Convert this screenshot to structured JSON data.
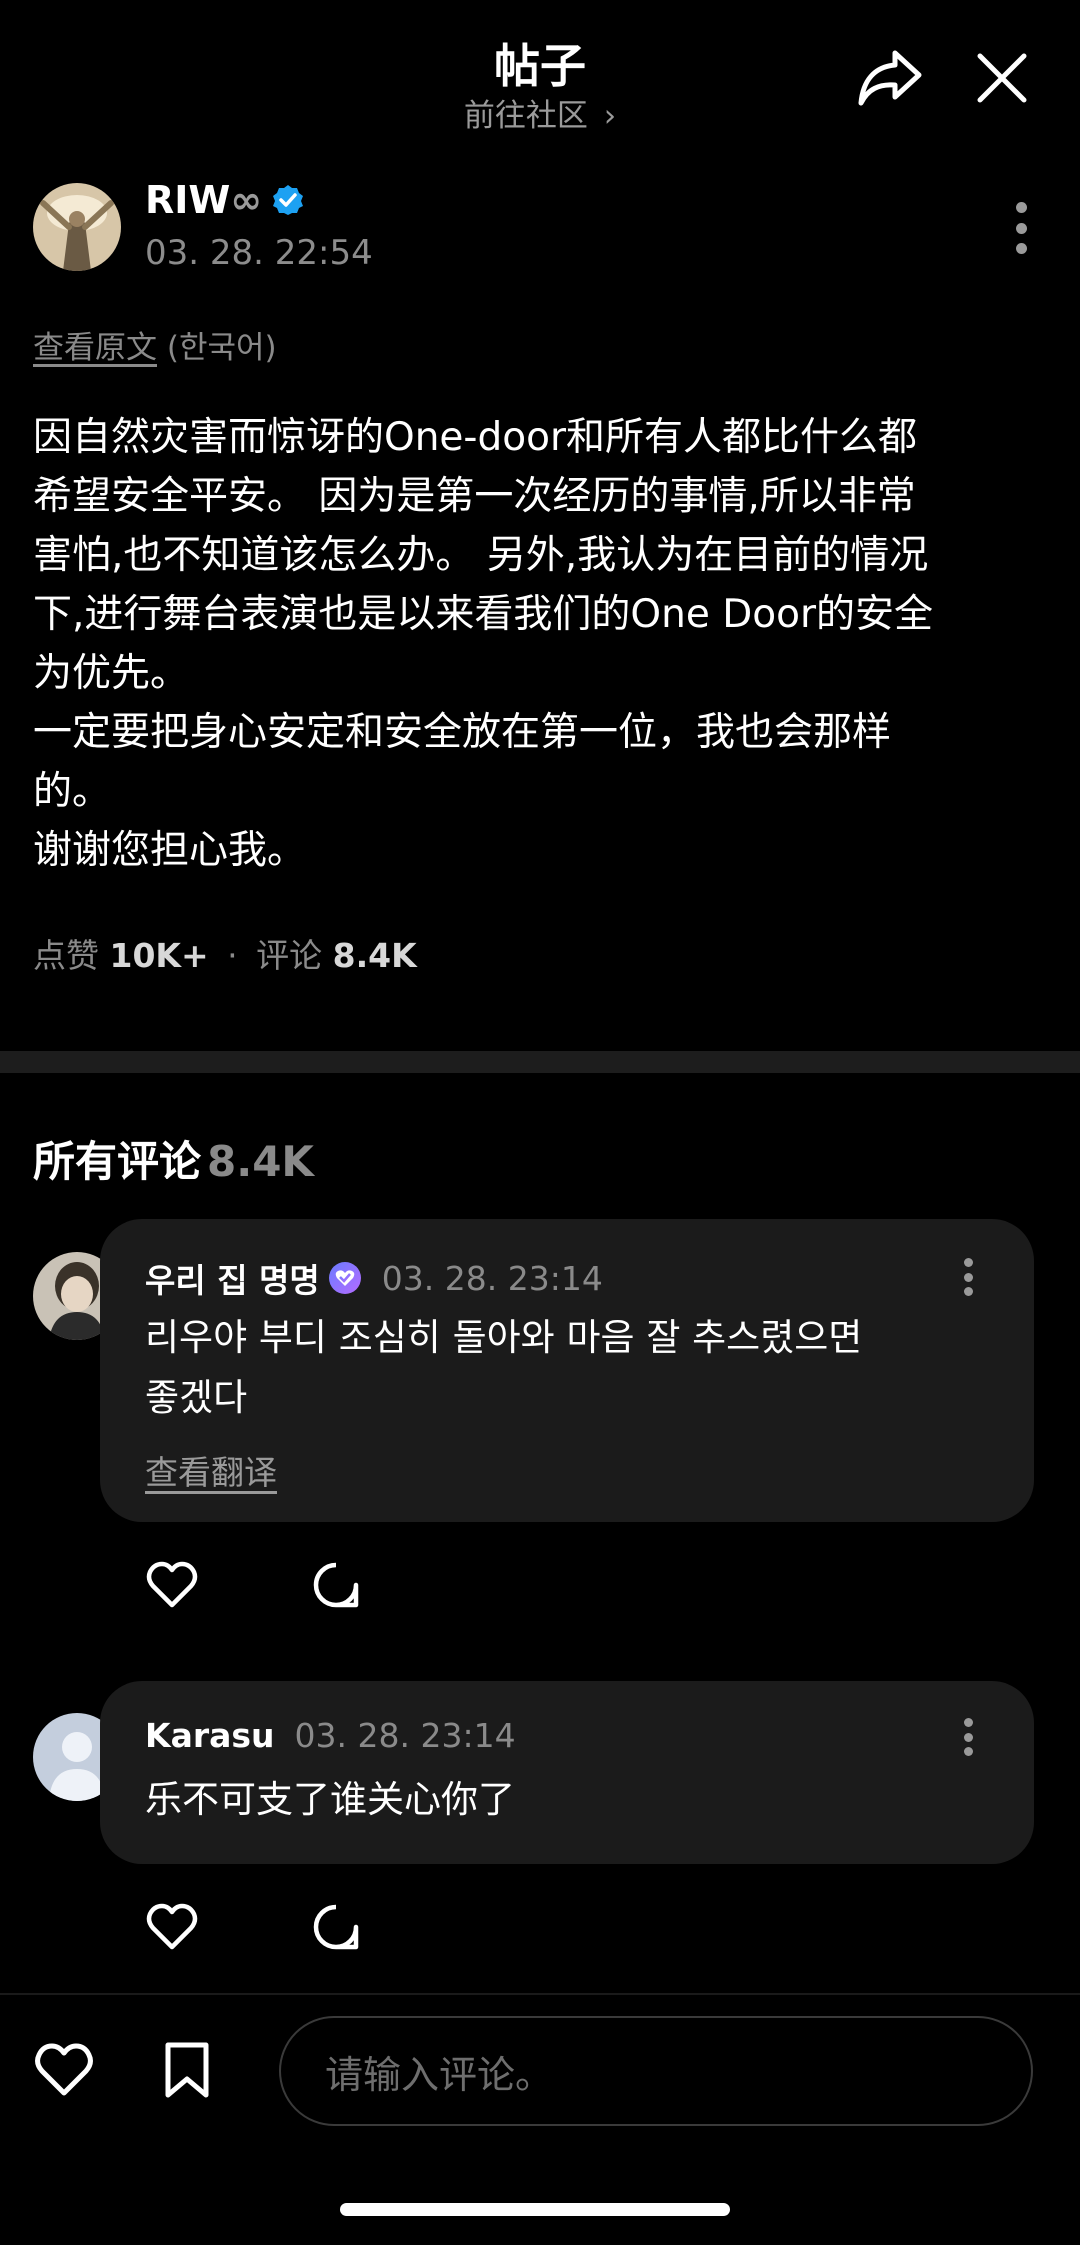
{
  "header": {
    "title": "帖子",
    "subtitle": "前往社区 ",
    "subtitle_chevron": "›"
  },
  "post": {
    "author": "RIW",
    "author_suffix": "∞",
    "verified": true,
    "timestamp": "03. 28. 22:54",
    "view_original": "查看原文",
    "original_lang": "(한국어)",
    "body": "因自然灾害而惊讶的One-door和所有人都比什么都\n希望安全平安。 因为是第一次经历的事情,所以非常\n害怕,也不知道该怎么办。 另外,我认为在目前的情况\n下,进行舞台表演也是以来看我们的One Door的安全\n为优先。\n一定要把身心安定和安全放在第一位，我也会那样\n的。\n谢谢您担心我。",
    "likes_label": "点赞",
    "likes_value": "10K+",
    "dot": "·",
    "comments_label": "评论",
    "comments_value": "8.4K"
  },
  "comments_section": {
    "title": "所有评论",
    "count": "8.4K"
  },
  "comments": [
    {
      "name": "우리 집 명명",
      "timestamp": "03. 28. 23:14",
      "text": "리우야 부디 조심히 돌아와 마음 잘 추스렸으면\n좋겠다",
      "translate": "查看翻译"
    },
    {
      "name": "Karasu",
      "timestamp": "03. 28. 23:14",
      "text": "乐不可支了谁关心你了"
    }
  ],
  "bottom_bar": {
    "input_placeholder": "请输入评论。"
  },
  "colors": {
    "background": "#000000",
    "bubble": "#1b1b1b",
    "verified": "#1da1f2",
    "muted": "#8a8a8a"
  },
  "icons": [
    "share-icon",
    "close-icon",
    "verified-badge-icon",
    "more-vertical-icon",
    "heart-icon",
    "comment-icon",
    "bookmark-icon"
  ]
}
